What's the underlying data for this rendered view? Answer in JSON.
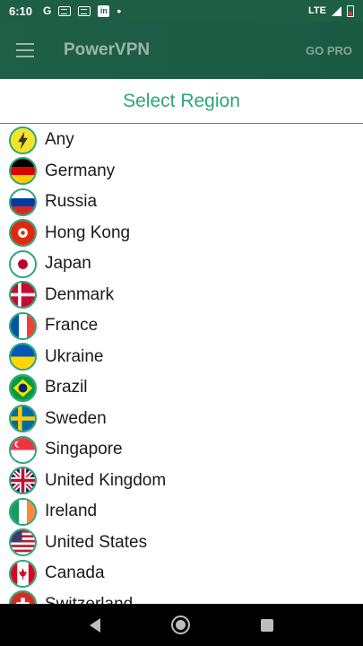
{
  "status_bar": {
    "time": "6:10",
    "notif_g": "G",
    "notif_li": "in",
    "notif_dot": "•",
    "network": "LTE"
  },
  "app_bar": {
    "title": "PowerVPN",
    "go_pro": "GO PRO"
  },
  "region_header": {
    "title": "Select Region"
  },
  "regions": [
    {
      "name": "Any",
      "flag": "lightning-icon"
    },
    {
      "name": "Germany",
      "flag": "germany-flag-icon"
    },
    {
      "name": "Russia",
      "flag": "russia-flag-icon"
    },
    {
      "name": "Hong Kong",
      "flag": "hong-kong-flag-icon"
    },
    {
      "name": "Japan",
      "flag": "japan-flag-icon"
    },
    {
      "name": "Denmark",
      "flag": "denmark-flag-icon"
    },
    {
      "name": "France",
      "flag": "france-flag-icon"
    },
    {
      "name": "Ukraine",
      "flag": "ukraine-flag-icon"
    },
    {
      "name": "Brazil",
      "flag": "brazil-flag-icon"
    },
    {
      "name": "Sweden",
      "flag": "sweden-flag-icon"
    },
    {
      "name": "Singapore",
      "flag": "singapore-flag-icon"
    },
    {
      "name": "United Kingdom",
      "flag": "uk-flag-icon"
    },
    {
      "name": "Ireland",
      "flag": "ireland-flag-icon"
    },
    {
      "name": "United States",
      "flag": "us-flag-icon"
    },
    {
      "name": "Canada",
      "flag": "canada-flag-icon"
    },
    {
      "name": "Switzerland",
      "flag": "switzerland-flag-icon"
    }
  ],
  "colors": {
    "app_bar": "#1d5e45",
    "accent": "#2ba678"
  }
}
